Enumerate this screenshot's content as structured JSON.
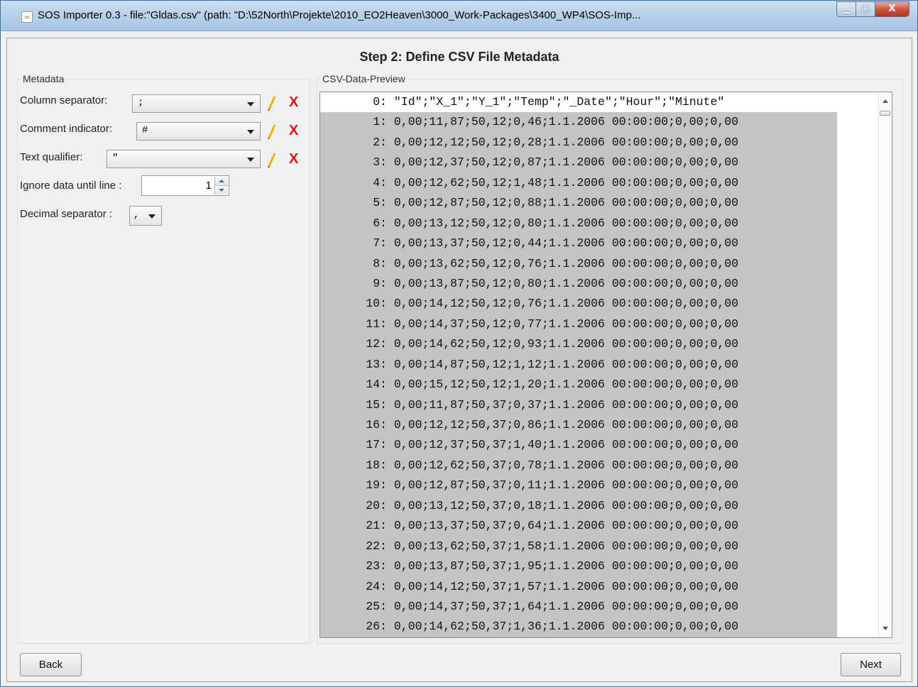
{
  "window": {
    "title": "SOS Importer 0.3 - file:\"Gldas.csv\" (path: \"D:\\52North\\Projekte\\2010_EO2Heaven\\3000_Work-Packages\\3400_WP4\\SOS-Imp...",
    "icon": "java-cup-icon",
    "controls": {
      "minimize_icon": "minimize-icon",
      "maximize_icon": "maximize-icon",
      "close_icon": "close-icon",
      "close_label": "X"
    }
  },
  "step_title": "Step 2: Define CSV File Metadata",
  "metadata": {
    "group_label": "Metadata",
    "column_separator": {
      "label": "Column separator:",
      "value": ";"
    },
    "comment_indicator": {
      "label": "Comment indicator:",
      "value": "#"
    },
    "text_qualifier": {
      "label": "Text qualifier:",
      "value": "\""
    },
    "ignore_until": {
      "label": "Ignore data until line :",
      "value": "1"
    },
    "decimal_separator": {
      "label": "Decimal separator :",
      "value": ","
    },
    "edit_icon": "pencil-icon",
    "delete_label": "X"
  },
  "preview": {
    "group_label": "CSV-Data-Preview",
    "lines": [
      {
        "n": "0:",
        "text": "\"Id\";\"X_1\";\"Y_1\";\"Temp\";\"_Date\";\"Hour\";\"Minute\""
      },
      {
        "n": "1:",
        "text": "0,00;11,87;50,12;0,46;1.1.2006 00:00:00;0,00;0,00"
      },
      {
        "n": "2:",
        "text": "0,00;12,12;50,12;0,28;1.1.2006 00:00:00;0,00;0,00"
      },
      {
        "n": "3:",
        "text": "0,00;12,37;50,12;0,87;1.1.2006 00:00:00;0,00;0,00"
      },
      {
        "n": "4:",
        "text": "0,00;12,62;50,12;1,48;1.1.2006 00:00:00;0,00;0,00"
      },
      {
        "n": "5:",
        "text": "0,00;12,87;50,12;0,88;1.1.2006 00:00:00;0,00;0,00"
      },
      {
        "n": "6:",
        "text": "0,00;13,12;50,12;0,80;1.1.2006 00:00:00;0,00;0,00"
      },
      {
        "n": "7:",
        "text": "0,00;13,37;50,12;0,44;1.1.2006 00:00:00;0,00;0,00"
      },
      {
        "n": "8:",
        "text": "0,00;13,62;50,12;0,76;1.1.2006 00:00:00;0,00;0,00"
      },
      {
        "n": "9:",
        "text": "0,00;13,87;50,12;0,80;1.1.2006 00:00:00;0,00;0,00"
      },
      {
        "n": "10:",
        "text": "0,00;14,12;50,12;0,76;1.1.2006 00:00:00;0,00;0,00"
      },
      {
        "n": "11:",
        "text": "0,00;14,37;50,12;0,77;1.1.2006 00:00:00;0,00;0,00"
      },
      {
        "n": "12:",
        "text": "0,00;14,62;50,12;0,93;1.1.2006 00:00:00;0,00;0,00"
      },
      {
        "n": "13:",
        "text": "0,00;14,87;50,12;1,12;1.1.2006 00:00:00;0,00;0,00"
      },
      {
        "n": "14:",
        "text": "0,00;15,12;50,12;1,20;1.1.2006 00:00:00;0,00;0,00"
      },
      {
        "n": "15:",
        "text": "0,00;11,87;50,37;0,37;1.1.2006 00:00:00;0,00;0,00"
      },
      {
        "n": "16:",
        "text": "0,00;12,12;50,37;0,86;1.1.2006 00:00:00;0,00;0,00"
      },
      {
        "n": "17:",
        "text": "0,00;12,37;50,37;1,40;1.1.2006 00:00:00;0,00;0,00"
      },
      {
        "n": "18:",
        "text": "0,00;12,62;50,37;0,78;1.1.2006 00:00:00;0,00;0,00"
      },
      {
        "n": "19:",
        "text": "0,00;12,87;50,37;0,11;1.1.2006 00:00:00;0,00;0,00"
      },
      {
        "n": "20:",
        "text": "0,00;13,12;50,37;0,18;1.1.2006 00:00:00;0,00;0,00"
      },
      {
        "n": "21:",
        "text": "0,00;13,37;50,37;0,64;1.1.2006 00:00:00;0,00;0,00"
      },
      {
        "n": "22:",
        "text": "0,00;13,62;50,37;1,58;1.1.2006 00:00:00;0,00;0,00"
      },
      {
        "n": "23:",
        "text": "0,00;13,87;50,37;1,95;1.1.2006 00:00:00;0,00;0,00"
      },
      {
        "n": "24:",
        "text": "0,00;14,12;50,37;1,57;1.1.2006 00:00:00;0,00;0,00"
      },
      {
        "n": "25:",
        "text": "0,00;14,37;50,37;1,64;1.1.2006 00:00:00;0,00;0,00"
      },
      {
        "n": "26:",
        "text": "0,00;14,62;50,37;1,36;1.1.2006 00:00:00;0,00;0,00"
      }
    ]
  },
  "buttons": {
    "back": "Back",
    "next": "Next"
  },
  "colors": {
    "delete": "#e01010",
    "edit": "#e8b800",
    "shade": "#c4c4c4"
  }
}
